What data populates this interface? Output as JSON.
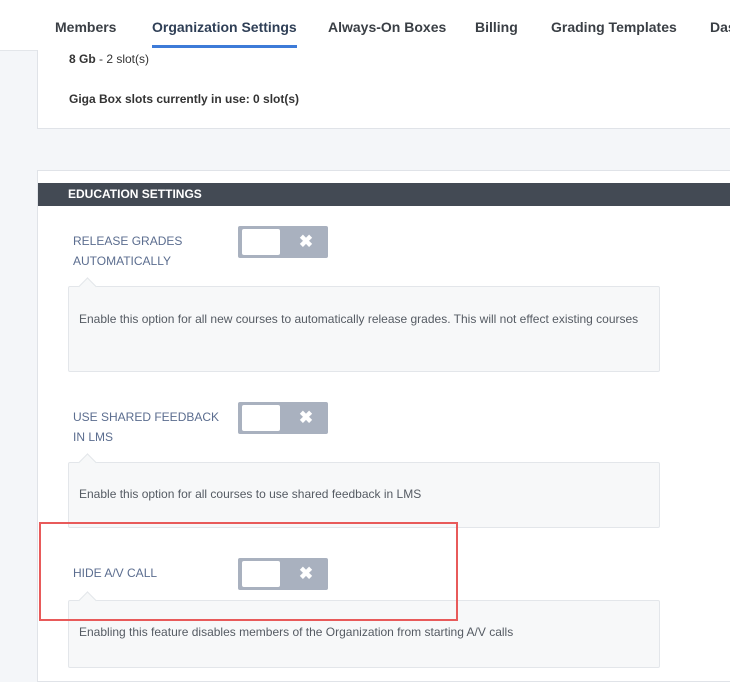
{
  "nav": {
    "tabs": [
      {
        "label": "Members"
      },
      {
        "label": "Organization Settings",
        "active": true
      },
      {
        "label": "Always-On Boxes"
      },
      {
        "label": "Billing"
      },
      {
        "label": "Grading Templates"
      },
      {
        "label": "Das"
      }
    ]
  },
  "storage": {
    "slot_size": "8 Gb",
    "slot_count": " - 2 slot(s)",
    "in_use": "Giga Box slots currently in use: 0 slot(s)"
  },
  "education": {
    "header": "EDUCATION SETTINGS",
    "settings": [
      {
        "label": "RELEASE GRADES AUTOMATICALLY",
        "enabled": false,
        "toggle_off_glyph": "✖",
        "description": "Enable this option for all new courses to automatically release grades. This will not effect existing courses"
      },
      {
        "label": "USE SHARED FEEDBACK IN LMS",
        "enabled": false,
        "toggle_off_glyph": "✖",
        "description": "Enable this option for all courses to use shared feedback in LMS"
      },
      {
        "label": "HIDE A/V CALL",
        "enabled": false,
        "toggle_off_glyph": "✖",
        "description": "Enabling this feature disables members of the Organization from starting A/V calls"
      }
    ]
  },
  "colors": {
    "header_bg": "#434a54",
    "active_tab_underline": "#3d7bd8",
    "toggle_off": "#a9b1bf",
    "label_text": "#5b6d8f",
    "highlight_border": "#e85a5a"
  }
}
